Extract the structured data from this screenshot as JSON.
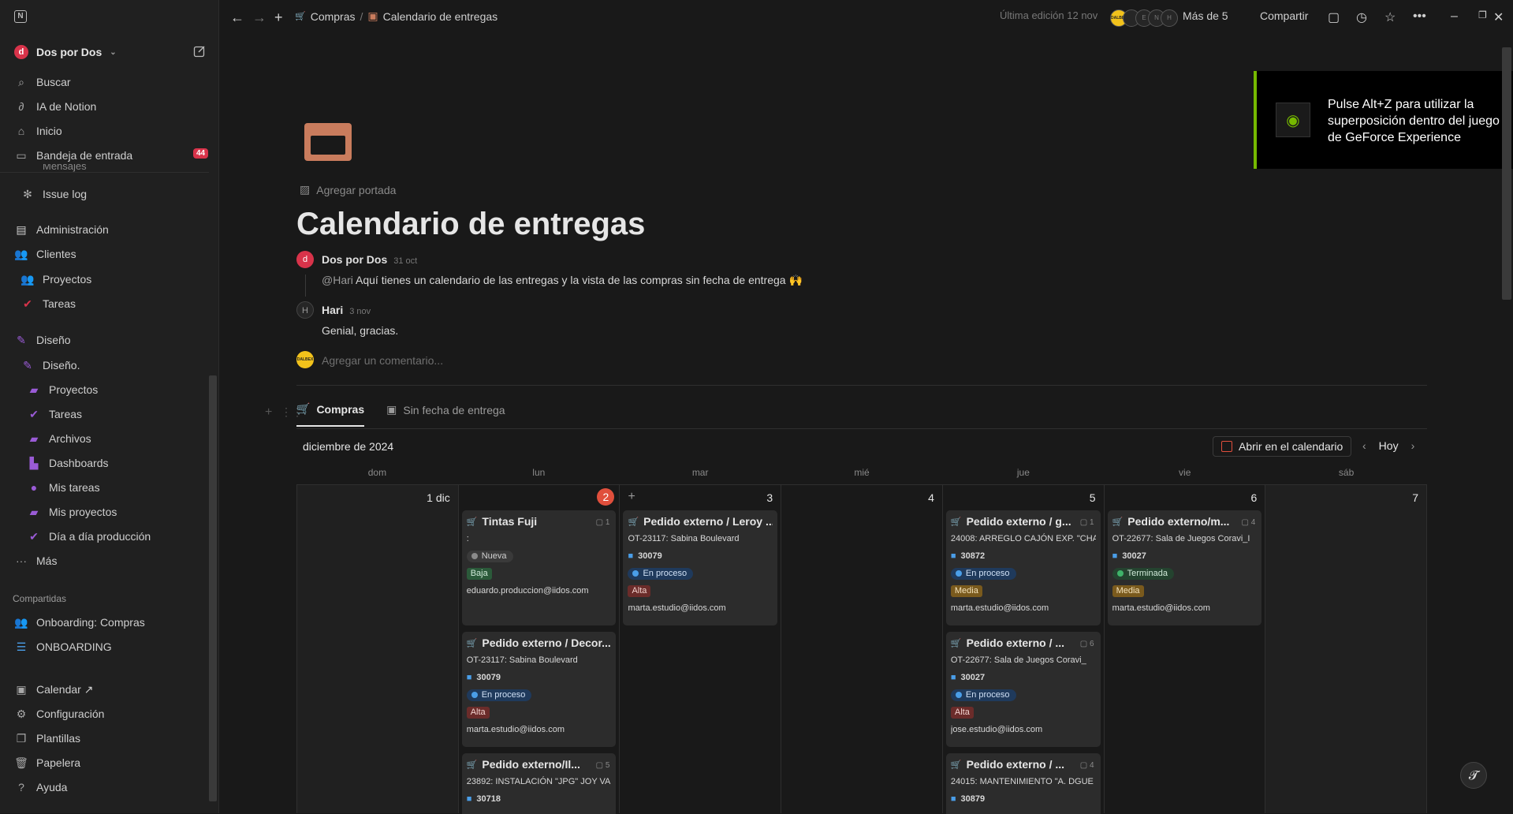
{
  "sidebar": {
    "workspace": "Dos por Dos",
    "top": [
      {
        "label": "Buscar",
        "icon": "search-icon"
      },
      {
        "label": "IA de Notion",
        "icon": "ai-icon"
      },
      {
        "label": "Inicio",
        "icon": "home-icon"
      },
      {
        "label": "Bandeja de entrada",
        "icon": "inbox-icon",
        "badge": "44"
      }
    ],
    "partial": "Mensajes",
    "items": [
      {
        "label": "Issue log",
        "icon": "bug-icon"
      },
      {
        "label": "Administración",
        "icon": "doc-icon"
      },
      {
        "label": "Clientes",
        "icon": "people-icon"
      },
      {
        "label": "Proyectos",
        "icon": "people-icon"
      },
      {
        "label": "Tareas",
        "icon": "check-icon"
      },
      {
        "label": "Diseño",
        "icon": "pen-icon"
      },
      {
        "label": "Diseño.",
        "icon": "pen-icon"
      },
      {
        "label": "Proyectos",
        "icon": "stack-icon"
      },
      {
        "label": "Tareas",
        "icon": "check-icon"
      },
      {
        "label": "Archivos",
        "icon": "stack-icon"
      },
      {
        "label": "Dashboards",
        "icon": "stairs-icon"
      },
      {
        "label": "Mis tareas",
        "icon": "person-icon"
      },
      {
        "label": "Mis proyectos",
        "icon": "stack-icon"
      },
      {
        "label": "Día a día producción",
        "icon": "check-icon"
      },
      {
        "label": "Más",
        "icon": "dots-icon"
      }
    ],
    "shared_title": "Compartidas",
    "shared": [
      {
        "label": "Onboarding: Compras",
        "icon": "people-icon"
      },
      {
        "label": "ONBOARDING",
        "icon": "list-icon"
      }
    ],
    "bottom": [
      {
        "label": "Calendar ↗",
        "icon": "calendar-icon"
      },
      {
        "label": "Configuración",
        "icon": "gear-icon"
      },
      {
        "label": "Plantillas",
        "icon": "template-icon"
      },
      {
        "label": "Papelera",
        "icon": "trash-icon"
      },
      {
        "label": "Ayuda",
        "icon": "help-icon"
      }
    ]
  },
  "nav": {
    "crumb1": "Compras",
    "sep": "/",
    "crumb2": "Calendario de entregas",
    "edited": "Última edición 12 nov",
    "avatar_brand": "DALBEX",
    "avatar_letters": [
      "",
      "E",
      "N",
      "H"
    ],
    "more": "Más de 5",
    "share": "Compartir"
  },
  "geforce": {
    "text": "Pulse Alt+Z para utilizar la superposición dentro del juego de GeForce Experience"
  },
  "page": {
    "add_cover": "Agregar portada",
    "title": "Calendario de entregas"
  },
  "comments": [
    {
      "author": "Dos por Dos",
      "date": "31 oct",
      "mention": "@Hari",
      "text": " Aquí tienes un calendario de las entregas y la vista de las compras sin fecha de entrega 🙌"
    },
    {
      "author": "Hari",
      "date": "3 nov",
      "initial": "H",
      "text": "Genial, gracias."
    }
  ],
  "comment_placeholder": "Agregar un comentario...",
  "tabs": [
    {
      "label": "Compras",
      "icon": "cart-icon"
    },
    {
      "label": "Sin fecha de entrega",
      "icon": "calendar-icon"
    }
  ],
  "calendar": {
    "month": "diciembre de 2024",
    "open_label": "Abrir en el calendario",
    "today_label": "Hoy",
    "weekdays": [
      "dom",
      "lun",
      "mar",
      "mié",
      "jue",
      "vie",
      "sáb"
    ],
    "dates": [
      "1 dic",
      "2",
      "3",
      "4",
      "5",
      "6",
      "7"
    ]
  },
  "cards": {
    "lun": [
      {
        "title": "Tintas Fuji",
        "comments": "1",
        "l1": ":",
        "status": "Nueva",
        "prio": "Baja",
        "email": "eduardo.produccion@iidos.com"
      },
      {
        "title": "Pedido externo / Decor...",
        "ot": "OT-23117: Sabina Boulevard",
        "num": "30079",
        "status": "En proceso",
        "prio": "Alta",
        "email": "marta.estudio@iidos.com"
      },
      {
        "title": "Pedido externo/Il...",
        "comments": "5",
        "ot": "23892: INSTALACIÓN \"JPG\" JOY VA",
        "num": "30718"
      }
    ],
    "mar": [
      {
        "title": "Pedido externo / Leroy ...",
        "ot": "OT-23117: Sabina Boulevard",
        "num": "30079",
        "status": "En proceso",
        "prio": "Alta",
        "email": "marta.estudio@iidos.com"
      }
    ],
    "jue": [
      {
        "title": "Pedido externo / g...",
        "comments": "1",
        "ot": "24008: ARREGLO CAJÓN EXP. \"CHA",
        "num": "30872",
        "status": "En proceso",
        "prio": "Media",
        "email": "marta.estudio@iidos.com"
      },
      {
        "title": "Pedido externo / ...",
        "comments": "6",
        "ot": "OT-22677: Sala de Juegos Coravi_",
        "num": "30027",
        "status": "En proceso",
        "prio": "Alta",
        "email": "jose.estudio@iidos.com"
      },
      {
        "title": "Pedido externo / ...",
        "comments": "4",
        "ot": "24015: MANTENIMIENTO \"A. DGUE",
        "num": "30879"
      }
    ],
    "vie": [
      {
        "title": "Pedido externo/m...",
        "comments": "4",
        "ot": "OT-22677: Sala de Juegos Coravi_I",
        "num": "30027",
        "status": "Terminada",
        "prio": "Media",
        "email": "marta.estudio@iidos.com"
      }
    ]
  }
}
